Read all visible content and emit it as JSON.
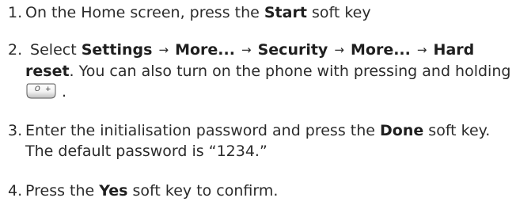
{
  "steps": [
    {
      "number": "1.",
      "text_before": "On the Home screen, press the ",
      "bold": "Start",
      "text_after": " soft key"
    },
    {
      "number": "2.",
      "select": "Select ",
      "path": [
        "Settings",
        "More...",
        "Security",
        "More...",
        "Hard reset"
      ],
      "arrow": "→",
      "text_after": ". You can also turn on the phone with pressing and holding ",
      "key_label_left": "O",
      "key_label_right": "+",
      "end": " ."
    },
    {
      "number": "3.",
      "text_before": "Enter the initialisation password and press the ",
      "bold": "Done",
      "text_after": " soft key. The default password is “1234.”"
    },
    {
      "number": "4.",
      "text_before": "Press the ",
      "bold": "Yes",
      "text_after": " soft key to confirm."
    }
  ],
  "icons": {
    "key": "zero-plus-key-icon"
  }
}
